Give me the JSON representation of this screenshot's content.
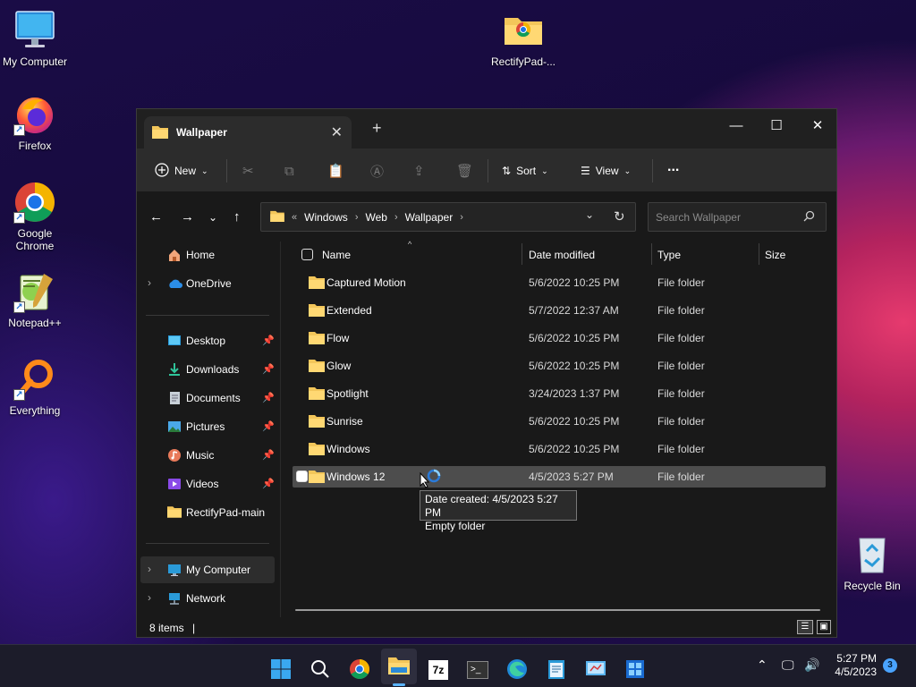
{
  "desktop": {
    "icons": [
      {
        "label": "My Computer",
        "icon": "monitor-icon"
      },
      {
        "label": "Firefox",
        "icon": "firefox-icon"
      },
      {
        "label": "Google Chrome",
        "icon": "chrome-icon"
      },
      {
        "label": "Notepad++",
        "icon": "notepadpp-icon"
      },
      {
        "label": "Everything",
        "icon": "everything-search-icon"
      },
      {
        "label": "RectifyPad-...",
        "icon": "zip-folder-icon"
      },
      {
        "label": "Recycle Bin",
        "icon": "recycle-bin-icon"
      }
    ]
  },
  "window": {
    "tab_title": "Wallpaper",
    "toolbar": {
      "new_label": "New",
      "sort_label": "Sort",
      "view_label": "View",
      "more_label": "..."
    },
    "breadcrumb": {
      "overflow": "«",
      "items": [
        "Windows",
        "Web",
        "Wallpaper"
      ]
    },
    "search": {
      "placeholder": "Search Wallpaper"
    },
    "sidebar": {
      "home": "Home",
      "onedrive": "OneDrive",
      "pinned": [
        {
          "label": "Desktop",
          "icon": "desktop-icon"
        },
        {
          "label": "Downloads",
          "icon": "download-icon"
        },
        {
          "label": "Documents",
          "icon": "documents-icon"
        },
        {
          "label": "Pictures",
          "icon": "pictures-icon"
        },
        {
          "label": "Music",
          "icon": "music-icon"
        },
        {
          "label": "Videos",
          "icon": "videos-icon"
        },
        {
          "label": "RectifyPad-main",
          "icon": "folder-icon"
        }
      ],
      "my_computer": "My Computer",
      "network": "Network"
    },
    "columns": {
      "name": "Name",
      "date": "Date modified",
      "type": "Type",
      "size": "Size"
    },
    "rows": [
      {
        "name": "Captured Motion",
        "date": "5/6/2022 10:25 PM",
        "type": "File folder"
      },
      {
        "name": "Extended",
        "date": "5/7/2022 12:37 AM",
        "type": "File folder"
      },
      {
        "name": "Flow",
        "date": "5/6/2022 10:25 PM",
        "type": "File folder"
      },
      {
        "name": "Glow",
        "date": "5/6/2022 10:25 PM",
        "type": "File folder"
      },
      {
        "name": "Spotlight",
        "date": "3/24/2023 1:37 PM",
        "type": "File folder"
      },
      {
        "name": "Sunrise",
        "date": "5/6/2022 10:25 PM",
        "type": "File folder"
      },
      {
        "name": "Windows",
        "date": "5/6/2022 10:25 PM",
        "type": "File folder"
      },
      {
        "name": "Windows 12",
        "date": "4/5/2023 5:27 PM",
        "type": "File folder"
      }
    ],
    "tooltip": {
      "line1": "Date created: 4/5/2023 5:27 PM",
      "line2": "Empty folder"
    },
    "status": {
      "items": "8 items"
    }
  },
  "taskbar": {
    "time": "5:27 PM",
    "date": "4/5/2023",
    "notifications": "3"
  },
  "colors": {
    "accent": "#5ab4ff",
    "folder": "#f3c65a",
    "window_bg": "#191919",
    "selection": "#4d4d4d"
  }
}
